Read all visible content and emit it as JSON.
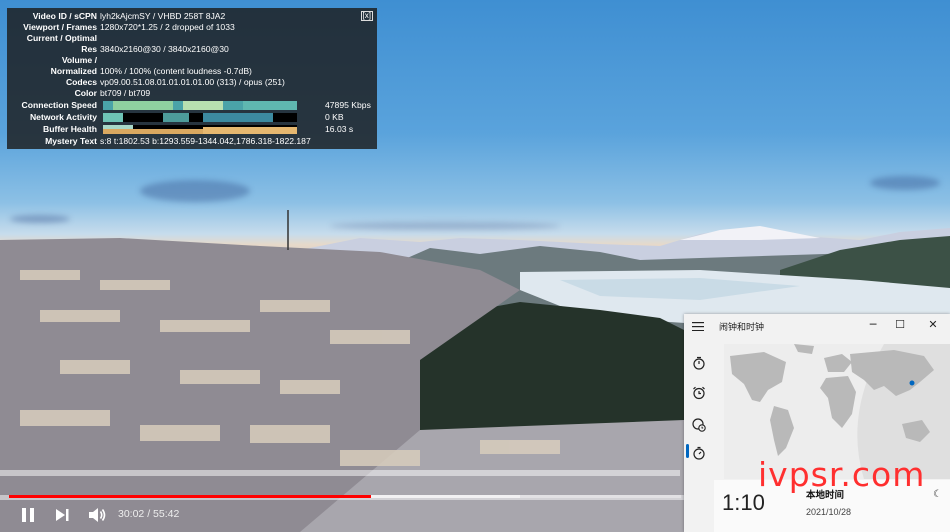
{
  "stats": {
    "close_label": "[x]",
    "rows": [
      {
        "label": "Video ID / sCPN",
        "value": "lyh2kAjcmSY / VHBD 258T 8JA2"
      },
      {
        "label": "Viewport / Frames",
        "value": "1280x720*1.25 / 2 dropped of 1033"
      },
      {
        "label": "Current / Optimal",
        "value": ""
      },
      {
        "label": "Res",
        "value": "3840x2160@30 / 3840x2160@30"
      },
      {
        "label": "Volume /",
        "value": ""
      },
      {
        "label": "Normalized",
        "value": "100% / 100% (content loudness -0.7dB)"
      },
      {
        "label": "Codecs",
        "value": "vp09.00.51.08.01.01.01.01.00 (313) / opus (251)"
      },
      {
        "label": "Color",
        "value": "bt709 / bt709"
      },
      {
        "label": "Connection Speed",
        "value": "47895 Kbps"
      },
      {
        "label": "Network Activity",
        "value": "0 KB"
      },
      {
        "label": "Buffer Health",
        "value": "16.03 s"
      },
      {
        "label": "Mystery Text",
        "value": "s:8 t:1802.53 b:1293.559-1344.042,1786.318-1822.187"
      }
    ]
  },
  "player": {
    "current_time": "30:02",
    "duration": "55:42",
    "time_display": "30:02 / 55:42",
    "progress": 0.539,
    "loaded": 0.76
  },
  "clock_app": {
    "title": "闹钟和时钟",
    "nav_icons": [
      "timer-icon",
      "alarm-icon",
      "world-clock-icon",
      "stopwatch-icon"
    ],
    "active_nav": "world-clock-icon",
    "time": "1:10",
    "place": "本地时间",
    "date": "2021/10/28"
  },
  "watermark": "ivpsr.com",
  "colors": {
    "progress_red": "#ff0000",
    "accent_blue": "#0067c0",
    "watermark_red": "#ff2f2f"
  }
}
